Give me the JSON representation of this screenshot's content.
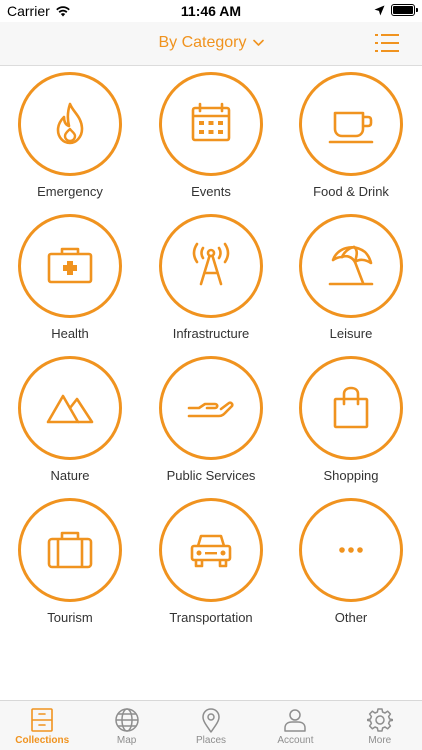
{
  "status": {
    "carrier": "Carrier",
    "time": "11:46 AM"
  },
  "nav": {
    "title": "By Category"
  },
  "categories": [
    {
      "label": "Emergency",
      "icon": "flame-icon"
    },
    {
      "label": "Events",
      "icon": "calendar-icon"
    },
    {
      "label": "Food & Drink",
      "icon": "coffee-cup-icon"
    },
    {
      "label": "Health",
      "icon": "first-aid-kit-icon"
    },
    {
      "label": "Infrastructure",
      "icon": "radio-tower-icon"
    },
    {
      "label": "Leisure",
      "icon": "beach-umbrella-icon"
    },
    {
      "label": "Nature",
      "icon": "mountains-icon"
    },
    {
      "label": "Public Services",
      "icon": "helping-hand-icon"
    },
    {
      "label": "Shopping",
      "icon": "shopping-bag-icon"
    },
    {
      "label": "Tourism",
      "icon": "suitcase-icon"
    },
    {
      "label": "Transportation",
      "icon": "car-icon"
    },
    {
      "label": "Other",
      "icon": "ellipsis-icon"
    }
  ],
  "tabs": [
    {
      "label": "Collections",
      "icon": "cabinet-icon"
    },
    {
      "label": "Map",
      "icon": "globe-icon"
    },
    {
      "label": "Places",
      "icon": "pin-icon"
    },
    {
      "label": "Account",
      "icon": "person-icon"
    },
    {
      "label": "More",
      "icon": "gear-icon"
    }
  ],
  "colors": {
    "accent": "#f0931f",
    "tab_inactive": "#8e8e8e",
    "bar_background": "#f7f7f7"
  }
}
